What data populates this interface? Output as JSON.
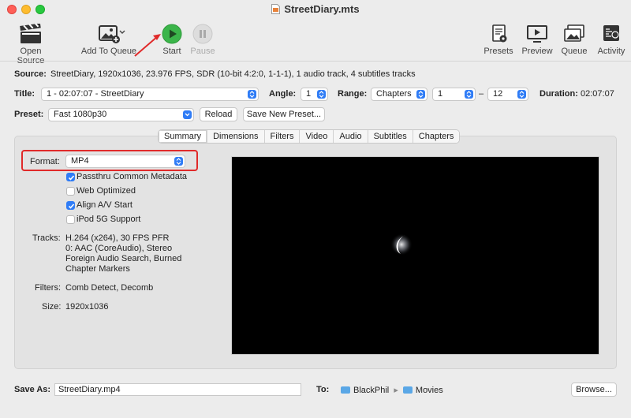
{
  "window": {
    "title": "StreetDiary.mts"
  },
  "toolbar": {
    "open_source": "Open Source",
    "add_to_queue": "Add To Queue",
    "start": "Start",
    "pause": "Pause",
    "presets": "Presets",
    "preview": "Preview",
    "queue": "Queue",
    "activity": "Activity"
  },
  "source": {
    "label": "Source:",
    "value": "StreetDiary, 1920x1036, 23.976 FPS, SDR (10-bit 4:2:0, 1-1-1), 1 audio track, 4 subtitles tracks"
  },
  "title_row": {
    "title_label": "Title:",
    "title_value": "1 - 02:07:07 - StreetDiary",
    "angle_label": "Angle:",
    "angle_value": "1",
    "range_label": "Range:",
    "range_type": "Chapters",
    "range_start": "1",
    "range_dash": "–",
    "range_end": "12",
    "duration_label": "Duration:",
    "duration_value": "02:07:07"
  },
  "preset_row": {
    "label": "Preset:",
    "value": "Fast 1080p30",
    "reload": "Reload",
    "save_new": "Save New Preset..."
  },
  "tabs": [
    "Summary",
    "Dimensions",
    "Filters",
    "Video",
    "Audio",
    "Subtitles",
    "Chapters"
  ],
  "summary": {
    "format_label": "Format:",
    "format_value": "MP4",
    "options": [
      {
        "label": "Passthru Common Metadata",
        "checked": true
      },
      {
        "label": "Web Optimized",
        "checked": false
      },
      {
        "label": "Align A/V Start",
        "checked": true
      },
      {
        "label": "iPod 5G Support",
        "checked": false
      }
    ],
    "tracks_label": "Tracks:",
    "tracks_lines": [
      "H.264 (x264), 30 FPS PFR",
      "0: AAC (CoreAudio), Stereo",
      "Foreign Audio Search, Burned",
      "Chapter Markers"
    ],
    "filters_label": "Filters:",
    "filters_value": "Comb Detect, Decomb",
    "size_label": "Size:",
    "size_value": "1920x1036"
  },
  "footer": {
    "save_as_label": "Save As:",
    "save_as_value": "StreetDiary.mp4",
    "to_label": "To:",
    "path_1": "BlackPhil",
    "path_sep": "▸",
    "path_2": "Movies",
    "browse": "Browse..."
  },
  "colors": {
    "accent": "#2f7cf6",
    "highlight": "#e02a2a",
    "start_green": "#3bb54a"
  }
}
